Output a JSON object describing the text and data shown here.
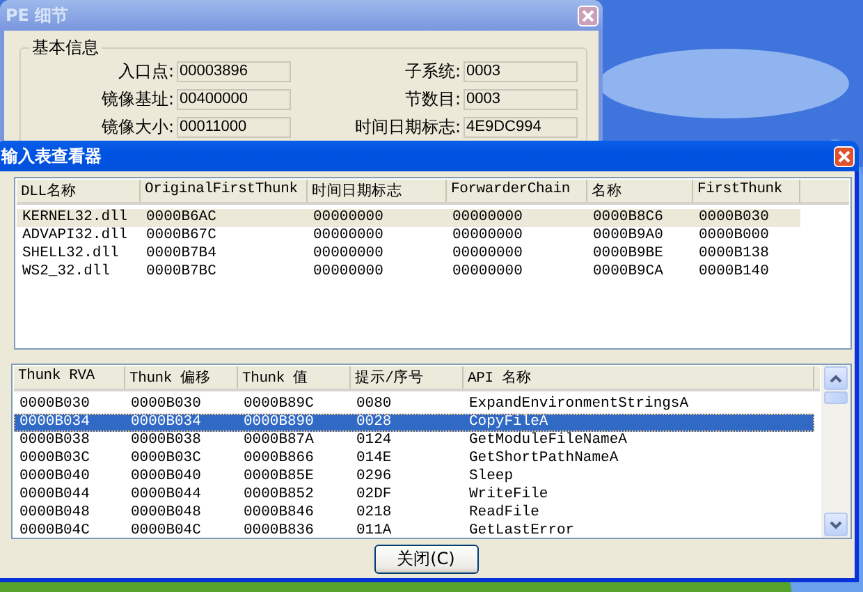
{
  "details_window": {
    "title": "PE 细节",
    "active": false,
    "group_title": "基本信息",
    "fields": [
      {
        "label": "入口点:",
        "value": "00003896"
      },
      {
        "label": "子系统:",
        "value": "0003"
      },
      {
        "label": "镜像基址:",
        "value": "00400000"
      },
      {
        "label": "节数目:",
        "value": "0003"
      },
      {
        "label": "镜像大小:",
        "value": "00011000"
      },
      {
        "label": "时间日期标志:",
        "value": "4E9DC994"
      }
    ]
  },
  "import_viewer": {
    "title": "输入表查看器",
    "active": true,
    "dll_table": {
      "focused": false,
      "columns": [
        "DLL名称",
        "OriginalFirstThunk",
        "时间日期标志",
        "ForwarderChain",
        "名称",
        "FirstThunk"
      ],
      "rows": [
        {
          "selected": true,
          "cells": [
            "KERNEL32.dll",
            "0000B6AC",
            "00000000",
            "00000000",
            "0000B8C6",
            "0000B030"
          ]
        },
        {
          "selected": false,
          "cells": [
            "ADVAPI32.dll",
            "0000B67C",
            "00000000",
            "00000000",
            "0000B9A0",
            "0000B000"
          ]
        },
        {
          "selected": false,
          "cells": [
            "SHELL32.dll",
            "0000B7B4",
            "00000000",
            "00000000",
            "0000B9BE",
            "0000B138"
          ]
        },
        {
          "selected": false,
          "cells": [
            "WS2_32.dll",
            "0000B7BC",
            "00000000",
            "00000000",
            "0000B9CA",
            "0000B140"
          ]
        }
      ]
    },
    "thunk_table": {
      "focused": true,
      "columns": [
        "Thunk RVA",
        "Thunk 偏移",
        "Thunk 值",
        "提示/序号",
        "API 名称"
      ],
      "rows": [
        {
          "selected": false,
          "cells": [
            "0000B030",
            "0000B030",
            "0000B89C",
            "0080",
            "ExpandEnvironmentStringsA"
          ]
        },
        {
          "selected": true,
          "cells": [
            "0000B034",
            "0000B034",
            "0000B890",
            "0028",
            "CopyFileA"
          ]
        },
        {
          "selected": false,
          "cells": [
            "0000B038",
            "0000B038",
            "0000B87A",
            "0124",
            "GetModuleFileNameA"
          ]
        },
        {
          "selected": false,
          "cells": [
            "0000B03C",
            "0000B03C",
            "0000B866",
            "014E",
            "GetShortPathNameA"
          ]
        },
        {
          "selected": false,
          "cells": [
            "0000B040",
            "0000B040",
            "0000B85E",
            "0296",
            "Sleep"
          ]
        },
        {
          "selected": false,
          "cells": [
            "0000B044",
            "0000B044",
            "0000B852",
            "02DF",
            "WriteFile"
          ]
        },
        {
          "selected": false,
          "cells": [
            "0000B048",
            "0000B048",
            "0000B846",
            "0218",
            "ReadFile"
          ]
        },
        {
          "selected": false,
          "cells": [
            "0000B04C",
            "0000B04C",
            "0000B836",
            "011A",
            "GetLastError"
          ]
        }
      ]
    },
    "close_button": "关闭(C)"
  }
}
